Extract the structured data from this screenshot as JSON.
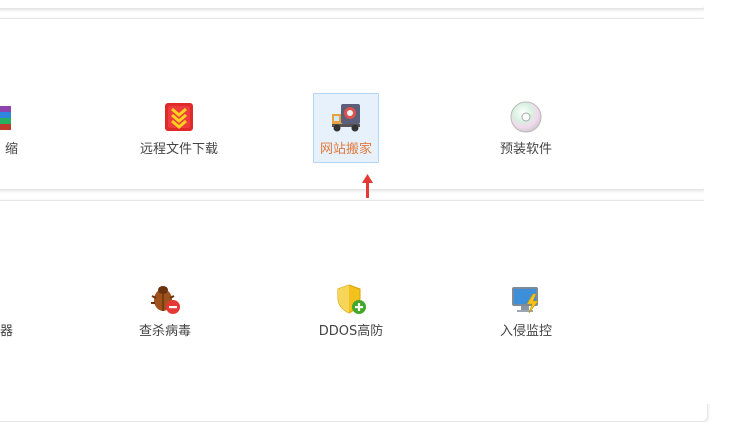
{
  "row1": {
    "items": [
      {
        "label": "缩",
        "icon": "archive-icon"
      },
      {
        "label": "远程文件下载",
        "icon": "download-arrows-icon"
      },
      {
        "label": "网站搬家",
        "icon": "moving-truck-icon",
        "selected": true
      },
      {
        "label": "预装软件",
        "icon": "cd-disc-icon"
      }
    ]
  },
  "row2": {
    "items": [
      {
        "label": "器",
        "icon": "partial-icon"
      },
      {
        "label": "查杀病毒",
        "icon": "bug-remove-icon"
      },
      {
        "label": "DDOS高防",
        "icon": "shield-plus-icon"
      },
      {
        "label": "入侵监控",
        "icon": "monitor-lightning-icon"
      }
    ]
  },
  "colors": {
    "selected_text": "#e0793c",
    "selected_bg": "#e7f1fb",
    "arrow": "#e53935"
  }
}
